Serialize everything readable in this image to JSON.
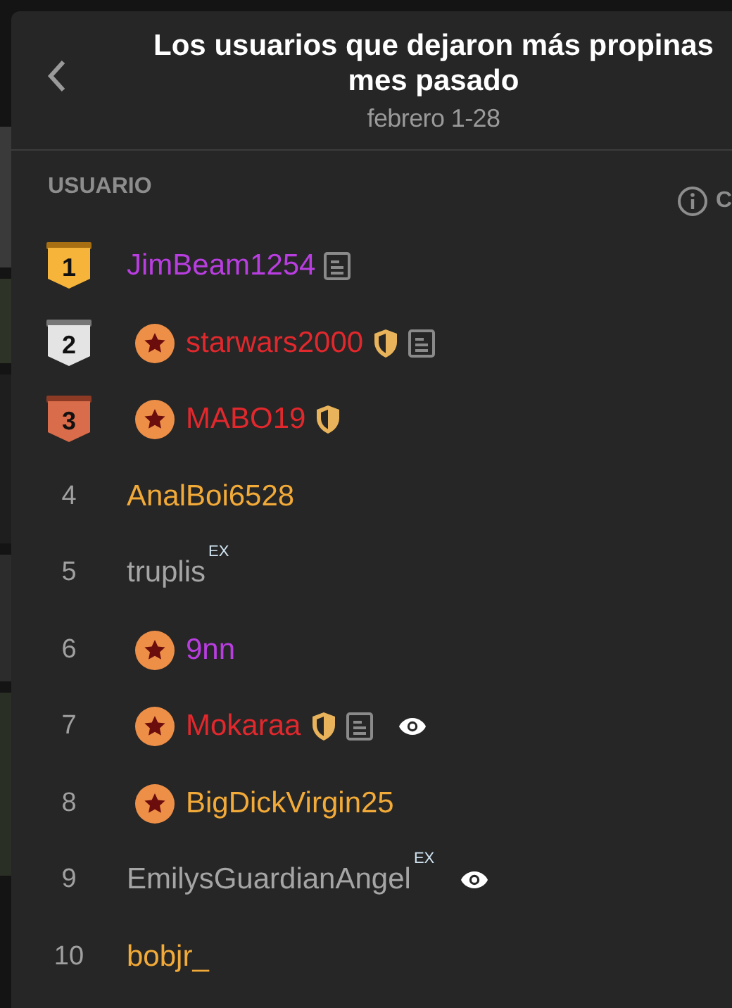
{
  "header": {
    "title": "Los usuarios que dejaron más propinas mes pasado",
    "subtitle": "febrero 1-28"
  },
  "columns": {
    "column_1": "USUARIO",
    "column_2": "C"
  },
  "rows": [
    {
      "rank": "1",
      "kind": "gold",
      "name": "JimBeam1254",
      "color": "#b93ee0",
      "star_badge": false,
      "shield": false,
      "note": true,
      "eye": false
    },
    {
      "rank": "2",
      "kind": "silver",
      "name": "starwars2000",
      "color": "#e1282d",
      "star_badge": true,
      "shield": true,
      "note": true,
      "eye": false
    },
    {
      "rank": "3",
      "kind": "bronze",
      "name": "MABO19",
      "color": "#e1282d",
      "star_badge": true,
      "shield": true,
      "note": false,
      "eye": false
    },
    {
      "rank": "4",
      "kind": "plain",
      "name": "AnalBoi6528",
      "color": "#f2aa38",
      "star_badge": false,
      "shield": false,
      "note": false,
      "eye": false
    },
    {
      "rank": "5",
      "kind": "plain",
      "name": "truplis",
      "color": "#a5a5a5",
      "star_badge": false,
      "shield": false,
      "note": false,
      "ex": "EX",
      "eye": false
    },
    {
      "rank": "6",
      "kind": "plain",
      "name": "9nn",
      "color": "#b93ee0",
      "star_badge": true,
      "shield": false,
      "note": false,
      "eye": false
    },
    {
      "rank": "7",
      "kind": "plain",
      "name": "Mokaraa",
      "color": "#e1282d",
      "star_badge": true,
      "shield": true,
      "note": true,
      "eye": true
    },
    {
      "rank": "8",
      "kind": "plain",
      "name": "BigDickVirgin25",
      "color": "#f2aa38",
      "star_badge": true,
      "shield": false,
      "note": false,
      "eye": false
    },
    {
      "rank": "9",
      "kind": "plain",
      "name": "EmilysGuardianAngel",
      "color": "#a5a5a5",
      "star_badge": false,
      "shield": false,
      "note": false,
      "ex": "EX",
      "eye": true
    },
    {
      "rank": "10",
      "kind": "plain",
      "name": "bobjr_",
      "color": "#f2aa38",
      "star_badge": false,
      "shield": false,
      "note": false,
      "eye": false
    }
  ]
}
